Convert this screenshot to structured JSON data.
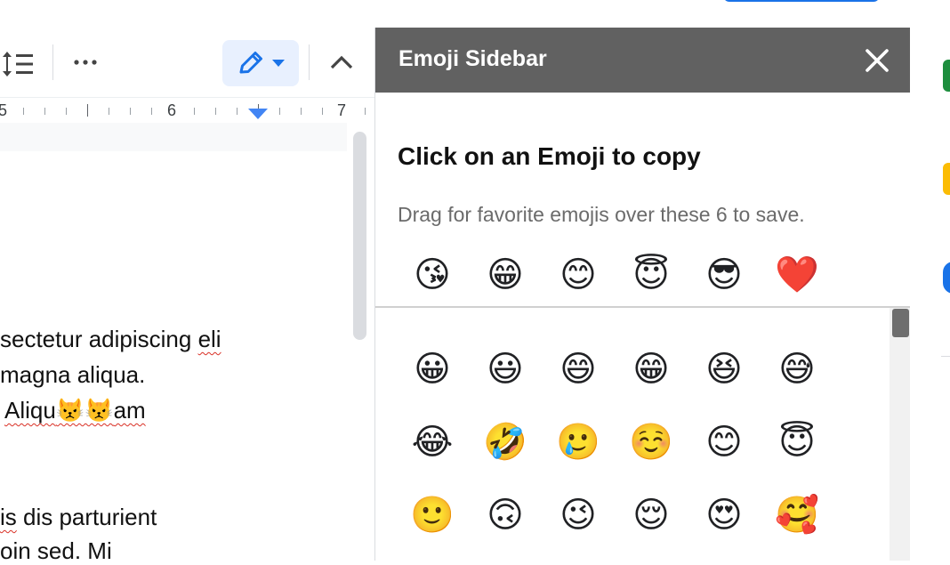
{
  "toolbar": {
    "line_spacing_icon": "line-spacing-icon",
    "more_icon": "more-horizontal-icon",
    "edit_icon": "pencil-icon",
    "dropdown_icon": "caret-down-icon",
    "collapse_icon": "chevron-up-icon",
    "accent": "#1a73e8",
    "edit_bg": "#e8f0fe"
  },
  "ruler": {
    "labels": [
      "5",
      "6",
      "7"
    ],
    "indent_marker_color": "#4285f4"
  },
  "document": {
    "lines": [
      {
        "pre": "sectetur adipiscing ",
        "mark": "eli",
        "post": ""
      },
      {
        "pre": " magna aliqua.",
        "mark": "",
        "post": ""
      },
      {
        "pre": "Aliqu",
        "emoji": "😾😾",
        "post": "am"
      },
      {
        "pre": "",
        "mark": "is",
        "post": " dis parturient"
      },
      {
        "pre": "oin sed. Mi",
        "mark": "",
        "post": ""
      }
    ]
  },
  "sidebar": {
    "title": "Emoji Sidebar",
    "close_icon": "close-icon",
    "heading": "Click on an Emoji to copy",
    "subheading": "Drag for favorite emojis over these 6 to save.",
    "header_color": "#616161",
    "favorites": [
      "😘",
      "😁",
      "😊",
      "😇",
      "😎",
      "❤️"
    ],
    "grid_rows": [
      [
        "😀",
        "😃",
        "😄",
        "😁",
        "😆",
        "😅"
      ],
      [
        "😂",
        "🤣",
        "🥲",
        "☺️",
        "😊",
        "😇"
      ],
      [
        "🙂",
        "🙃",
        "😉",
        "😌",
        "😍",
        "🥰"
      ]
    ]
  },
  "side_panel": {
    "icons": [
      {
        "name": "sheets-icon",
        "color": "#1e8e3e"
      },
      {
        "name": "keep-icon",
        "color": "#fbbc04"
      },
      {
        "name": "contacts-icon",
        "color": "#1a73e8"
      }
    ]
  }
}
